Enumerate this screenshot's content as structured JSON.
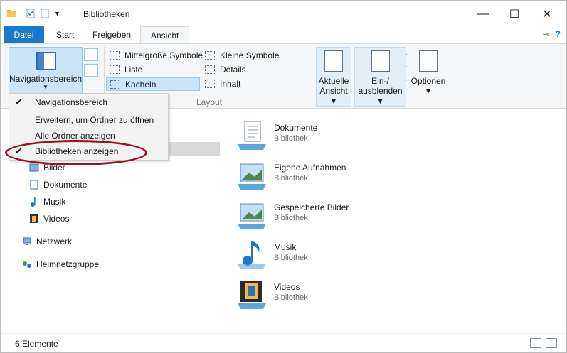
{
  "window": {
    "title": "Bibliotheken",
    "controls": {
      "minimize": "—",
      "maximize": "☐",
      "close": "✕"
    }
  },
  "tabs": [
    {
      "label": "Datei"
    },
    {
      "label": "Start"
    },
    {
      "label": "Freigeben"
    },
    {
      "label": "Ansicht"
    }
  ],
  "ribbon": {
    "nav_pane_label": "Navigationsbereich",
    "layout_items": [
      "Mittelgroße Symbole",
      "Kleine Symbole",
      "Liste",
      "Details",
      "Kacheln",
      "Inhalt"
    ],
    "layout_group_label": "Layout",
    "aktuelle_ansicht": [
      "Aktuelle",
      "Ansicht"
    ],
    "ein_ausblenden": [
      "Ein-/",
      "ausblenden"
    ],
    "optionen": "Optionen"
  },
  "menu": {
    "items": [
      {
        "label": "Navigationsbereich",
        "checked": true
      },
      {
        "label": "Erweitern, um Ordner zu öffnen",
        "checked": false
      },
      {
        "label": "Alle Ordner anzeigen",
        "checked": false
      },
      {
        "label": "Bibliotheken anzeigen",
        "checked": true
      }
    ]
  },
  "nav": {
    "items": [
      "Bilder",
      "Dokumente",
      "Musik",
      "Videos",
      "Netzwerk",
      "Heimnetzgruppe"
    ]
  },
  "content": {
    "tiles": [
      {
        "name": "Dokumente",
        "sub": "Bibliothek"
      },
      {
        "name": "Eigene Aufnahmen",
        "sub": "Bibliothek"
      },
      {
        "name": "Gespeicherte Bilder",
        "sub": "Bibliothek"
      },
      {
        "name": "Musik",
        "sub": "Bibliothek"
      },
      {
        "name": "Videos",
        "sub": "Bibliothek"
      }
    ]
  },
  "status": {
    "count": "6 Elemente"
  },
  "colors": {
    "accent": "#1979ca",
    "highlight": "#a10f22",
    "selection": "#cce4f7"
  }
}
